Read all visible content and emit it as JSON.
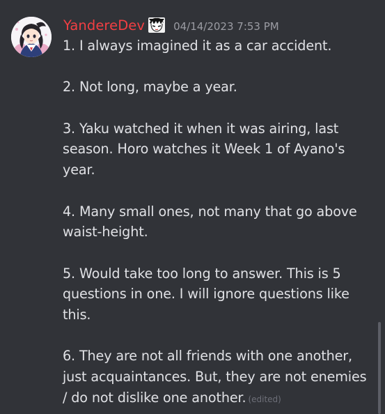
{
  "message": {
    "username": "YandereDev",
    "timestamp": "04/14/2023 7:53 PM",
    "paragraphs": [
      "1. I always imagined it as a car accident.",
      "2. Not long, maybe a year.",
      "3. Yaku watched it when it was airing, last season. Horo watches it Week 1 of Ayano's year.",
      "4. Many small ones, not many that go above waist-height.",
      "5. Would take too long to answer. This is 5 questions in one. I will ignore questions like this.",
      "6. They are not all friends with one another, just acquaintances. But, they are not enemies / do not dislike one another."
    ],
    "edited_label": "(edited)"
  },
  "icons": {
    "avatar": "anime-girl-avatar",
    "role": "anime-character-role-icon"
  },
  "colors": {
    "background": "#313338",
    "username": "#f23f43",
    "text": "#e0e1e5",
    "timestamp": "#9b9ca3",
    "edited": "#6d6f78"
  }
}
